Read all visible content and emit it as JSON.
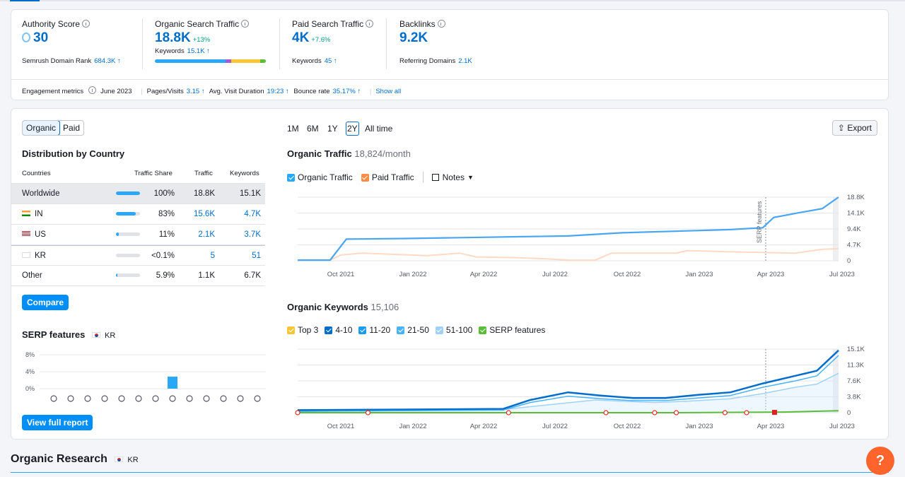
{
  "summary": {
    "authority": {
      "label": "Authority Score",
      "value": "30",
      "sub_label": "Semrush Domain Rank",
      "sub_value": "684.3K ↑"
    },
    "organic": {
      "label": "Organic Search Traffic",
      "value": "18.8K",
      "change": "+13%",
      "sub_label": "Keywords",
      "sub_value": "15.1K ↑"
    },
    "paid": {
      "label": "Paid Search Traffic",
      "value": "4K",
      "change": "+7.6%",
      "sub_label": "Keywords",
      "sub_value": "45 ↑"
    },
    "backlinks": {
      "label": "Backlinks",
      "value": "9.2K",
      "sub_label": "Referring Domains",
      "sub_value": "2.1K"
    }
  },
  "engagement": {
    "label": "Engagement metrics",
    "date": "June 2023",
    "pages_label": "Pages/Visits",
    "pages_value": "3.15 ↑",
    "duration_label": "Avg. Visit Duration",
    "duration_value": "19:23 ↑",
    "bounce_label": "Bounce rate",
    "bounce_value": "35.17% ↑",
    "show_all": "Show all"
  },
  "toggle": {
    "organic": "Organic",
    "paid": "Paid"
  },
  "distribution": {
    "title": "Distribution by Country",
    "headers": {
      "country": "Countries",
      "share": "Traffic Share",
      "traffic": "Traffic",
      "keywords": "Keywords"
    },
    "rows": [
      {
        "country": "Worldwide",
        "share": "100%",
        "share_fraction": 1.0,
        "traffic": "18.8K",
        "keywords": "15.1K"
      },
      {
        "country": "IN",
        "share": "83%",
        "share_fraction": 0.83,
        "traffic": "15.6K",
        "keywords": "4.7K"
      },
      {
        "country": "US",
        "share": "11%",
        "share_fraction": 0.11,
        "traffic": "2.1K",
        "keywords": "3.7K"
      },
      {
        "country": "KR",
        "share": "<0.1%",
        "share_fraction": 0.0,
        "traffic": "5",
        "keywords": "51"
      },
      {
        "country": "Other",
        "share": "5.9%",
        "share_fraction": 0.059,
        "traffic": "1.1K",
        "keywords": "6.7K"
      }
    ],
    "compare": "Compare"
  },
  "serp": {
    "title": "SERP features",
    "country": "KR",
    "y_ticks": [
      "8%",
      "4%",
      "0%"
    ],
    "bar_values": [
      0,
      0,
      0,
      0,
      0,
      0,
      0,
      3,
      0,
      0,
      0,
      0,
      0
    ],
    "view_full": "View full report"
  },
  "ranges": [
    "1M",
    "6M",
    "1Y",
    "2Y",
    "All time"
  ],
  "export": "Export",
  "traffic_chart": {
    "title": "Organic Traffic",
    "value": "18,824/month",
    "legend": {
      "organic": "Organic Traffic",
      "paid": "Paid Traffic",
      "notes": "Notes"
    },
    "serp_marker": "SERP features",
    "y_ticks": [
      "18.8K",
      "14.1K",
      "9.4K",
      "4.7K",
      "0"
    ],
    "x_ticks": [
      "Oct 2021",
      "Jan 2022",
      "Apr 2022",
      "Jul 2022",
      "Oct 2022",
      "Jan 2023",
      "Apr 2023",
      "Jul 2023"
    ]
  },
  "keywords_chart": {
    "title": "Organic Keywords",
    "value": "15,106",
    "legend": [
      "Top 3",
      "4-10",
      "11-20",
      "21-50",
      "51-100",
      "SERP features"
    ],
    "legend_colors": [
      "#f8c635",
      "#006dca",
      "#1d9bf0",
      "#48b3f8",
      "#9fd2fa",
      "#5bbd37"
    ],
    "y_ticks": [
      "15.1K",
      "11.3K",
      "7.6K",
      "3.8K",
      "0"
    ],
    "x_ticks": [
      "Oct 2021",
      "Jan 2022",
      "Apr 2022",
      "Jul 2022",
      "Oct 2022",
      "Jan 2023",
      "Apr 2023",
      "Jul 2023"
    ]
  },
  "footer": {
    "title": "Organic Research",
    "country": "KR"
  },
  "help": "?"
}
